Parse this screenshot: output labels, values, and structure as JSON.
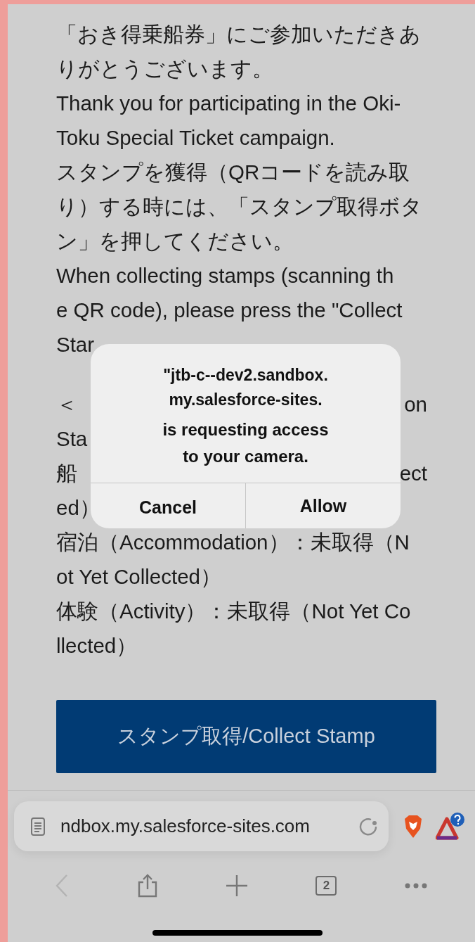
{
  "content": {
    "paragraphs": [
      [
        {
          "kind": "full",
          "text": "「おき得乗船券」にご参加いただきあ"
        },
        {
          "kind": "full",
          "text": "りがとうございます。"
        },
        {
          "kind": "full",
          "text": "Thank you for participating in the Oki-"
        },
        {
          "kind": "full",
          "text": "Toku Special Ticket campaign."
        },
        {
          "kind": "full",
          "text": "スタンプを獲得（QRコードを読み取"
        },
        {
          "kind": "full",
          "text": "り）する時には、「スタンプ取得ボタ"
        },
        {
          "kind": "full",
          "text": "ン」を押してください。"
        },
        {
          "kind": "full",
          "text": "When collecting stamps (scanning th"
        },
        {
          "kind": "full",
          "text": "e QR code), please press the \"Collect"
        },
        {
          "kind": "split",
          "left": "Star"
        }
      ],
      [
        {
          "kind": "split",
          "left": "＜",
          "right": "on"
        },
        {
          "kind": "split",
          "left": "Sta"
        },
        {
          "kind": "split",
          "left": "船",
          "right": "ect"
        },
        {
          "kind": "split",
          "left": "ed）"
        },
        {
          "kind": "full",
          "text": "宿泊（Accommodation）：未取得（N"
        },
        {
          "kind": "full",
          "text": "ot Yet Collected）"
        },
        {
          "kind": "full",
          "text": "体験（Activity）：未取得（Not Yet Co"
        },
        {
          "kind": "full",
          "text": "llected）"
        }
      ]
    ],
    "button": "スタンプ取得/Collect Stamp"
  },
  "dialog": {
    "title_lines": [
      "\"jtb-c--dev2.sandbox.",
      "my.salesforce-sites."
    ],
    "message_lines": [
      "is requesting access",
      "to your camera."
    ],
    "buttons": [
      "Cancel",
      "Allow"
    ]
  },
  "browser": {
    "url": "ndbox.my.salesforce-sites.com",
    "tab_count": "2",
    "back_disabled": true
  }
}
